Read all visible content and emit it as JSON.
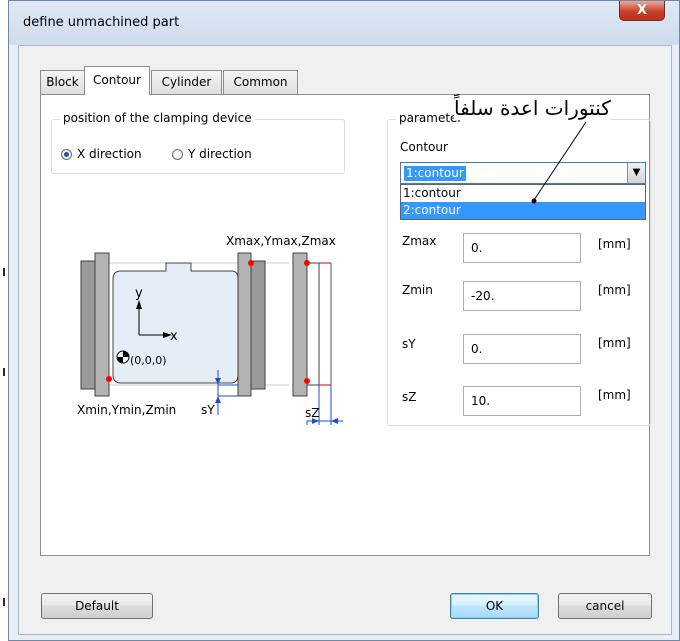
{
  "window": {
    "title": "define unmachined part",
    "close_glyph": "X"
  },
  "tabs": [
    {
      "label": "Block"
    },
    {
      "label": "Contour"
    },
    {
      "label": "Cylinder"
    },
    {
      "label": "Common"
    }
  ],
  "active_tab": "Contour",
  "clamping": {
    "title": "position of the clamping device",
    "options": [
      {
        "label": "X direction"
      },
      {
        "label": "Y direction"
      }
    ],
    "selected": "X direction"
  },
  "diagram": {
    "max_label": "Xmax,Ymax,Zmax",
    "min_label": "Xmin,Ymin,Zmin",
    "origin_label": "(0,0,0)",
    "x_axis": "x",
    "y_axis": "y",
    "sy_label": "sY",
    "sz_label": "sZ"
  },
  "parameter": {
    "title": "parameter",
    "contour_label": "Contour",
    "contour_value": "1:contour",
    "dropdown_items": [
      "1:contour",
      "2:contour"
    ],
    "highlighted_item": "2:contour",
    "fields": [
      {
        "label": "Zmax",
        "value": "0.",
        "unit": "[mm]"
      },
      {
        "label": "Zmin",
        "value": "-20.",
        "unit": "[mm]"
      },
      {
        "label": "sY",
        "value": "0.",
        "unit": "[mm]"
      },
      {
        "label": "sZ",
        "value": "10.",
        "unit": "[mm]"
      }
    ]
  },
  "annotation": {
    "text": "كنتورات اعدة سلفاً"
  },
  "buttons": {
    "default": "Default",
    "ok": "OK",
    "cancel": "cancel"
  },
  "colors": {
    "selection": "#3399ff",
    "marker_red": "#ff0000",
    "dimension_blue": "#1f4fd0",
    "part_fill": "#e5eef7"
  }
}
